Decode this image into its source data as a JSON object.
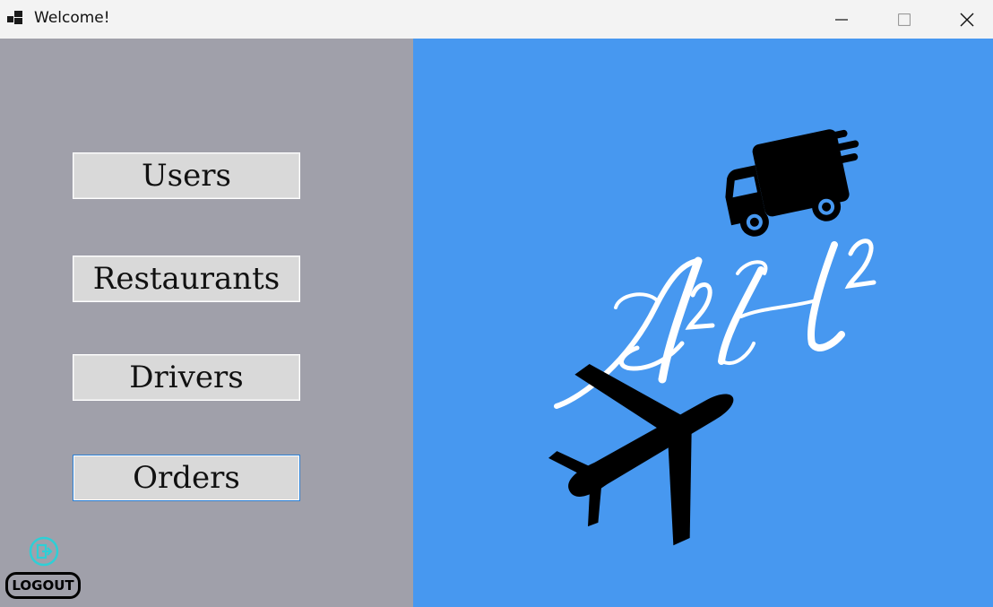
{
  "window": {
    "title": "Welcome!",
    "controls": [
      "minimize",
      "maximize",
      "close"
    ]
  },
  "menu": {
    "buttons": [
      {
        "label": "Users"
      },
      {
        "label": "Restaurants"
      },
      {
        "label": "Drivers"
      },
      {
        "label": "Orders",
        "focused": true
      }
    ]
  },
  "logout": {
    "label": "LOGOUT",
    "icon": "logout-icon"
  },
  "logo": {
    "icons": [
      "delivery-truck-icon",
      "airplane-icon"
    ]
  },
  "colors": {
    "left_panel": "#a0a0aa",
    "right_panel": "#4798f0",
    "button": "#d9d9d9",
    "focus_border": "#2a7fd4",
    "logout_icon": "#2ecfd6"
  }
}
